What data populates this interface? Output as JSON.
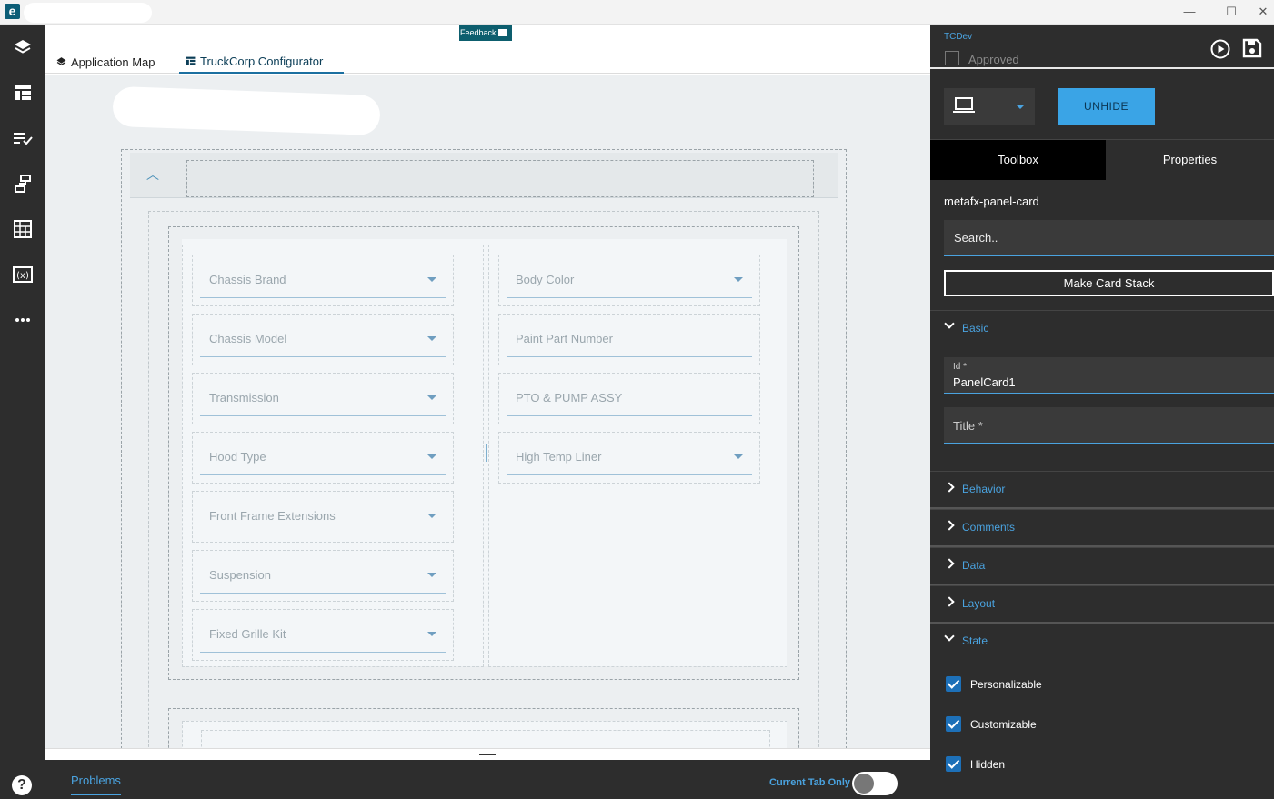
{
  "window": {
    "logo_letter": "e",
    "minimize": "—",
    "maximize": "☐",
    "close": "✕"
  },
  "tabs": [
    {
      "label": "Application Map"
    },
    {
      "label": "TruckCorp Configurator"
    }
  ],
  "feedback_label": "Feedback",
  "form": {
    "left_fields": [
      {
        "label": "Chassis Brand",
        "dropdown": true
      },
      {
        "label": "Chassis Model",
        "dropdown": true
      },
      {
        "label": "Transmission",
        "dropdown": true
      },
      {
        "label": "Hood Type",
        "dropdown": true
      },
      {
        "label": "Front Frame Extensions",
        "dropdown": true
      },
      {
        "label": "Suspension",
        "dropdown": true
      },
      {
        "label": "Fixed Grille Kit",
        "dropdown": true
      }
    ],
    "right_fields": [
      {
        "label": "Body Color",
        "dropdown": true
      },
      {
        "label": "Paint Part Number",
        "dropdown": false
      },
      {
        "label": "PTO & PUMP ASSY",
        "dropdown": false
      },
      {
        "label": "High Temp Liner",
        "dropdown": true
      }
    ]
  },
  "bottom": {
    "problems_tab": "Problems",
    "current_tab_only": "Current Tab Only",
    "toggle_on": false
  },
  "right_panel": {
    "environment": "TCDev",
    "approved_label": "Approved",
    "approved_checked": false,
    "unhide_button": "UNHIDE",
    "tabs": {
      "toolbox": "Toolbox",
      "properties": "Properties"
    },
    "component_name": "metafx-panel-card",
    "search_placeholder": "Search..",
    "make_card_stack": "Make Card Stack",
    "sections": {
      "basic": "Basic",
      "behavior": "Behavior",
      "comments": "Comments",
      "data": "Data",
      "layout": "Layout",
      "state": "State"
    },
    "id_label": "Id *",
    "id_value": "PanelCard1",
    "title_label": "Title *",
    "state_options": [
      {
        "label": "Personalizable",
        "checked": true
      },
      {
        "label": "Customizable",
        "checked": true
      },
      {
        "label": "Hidden",
        "checked": true
      }
    ]
  },
  "help_label": "?",
  "colors": {
    "accent": "#4aa3e0",
    "button_blue": "#3aa4e6",
    "dark_bg": "#2d2d2d",
    "feedback_bg": "#0d5e6e"
  }
}
